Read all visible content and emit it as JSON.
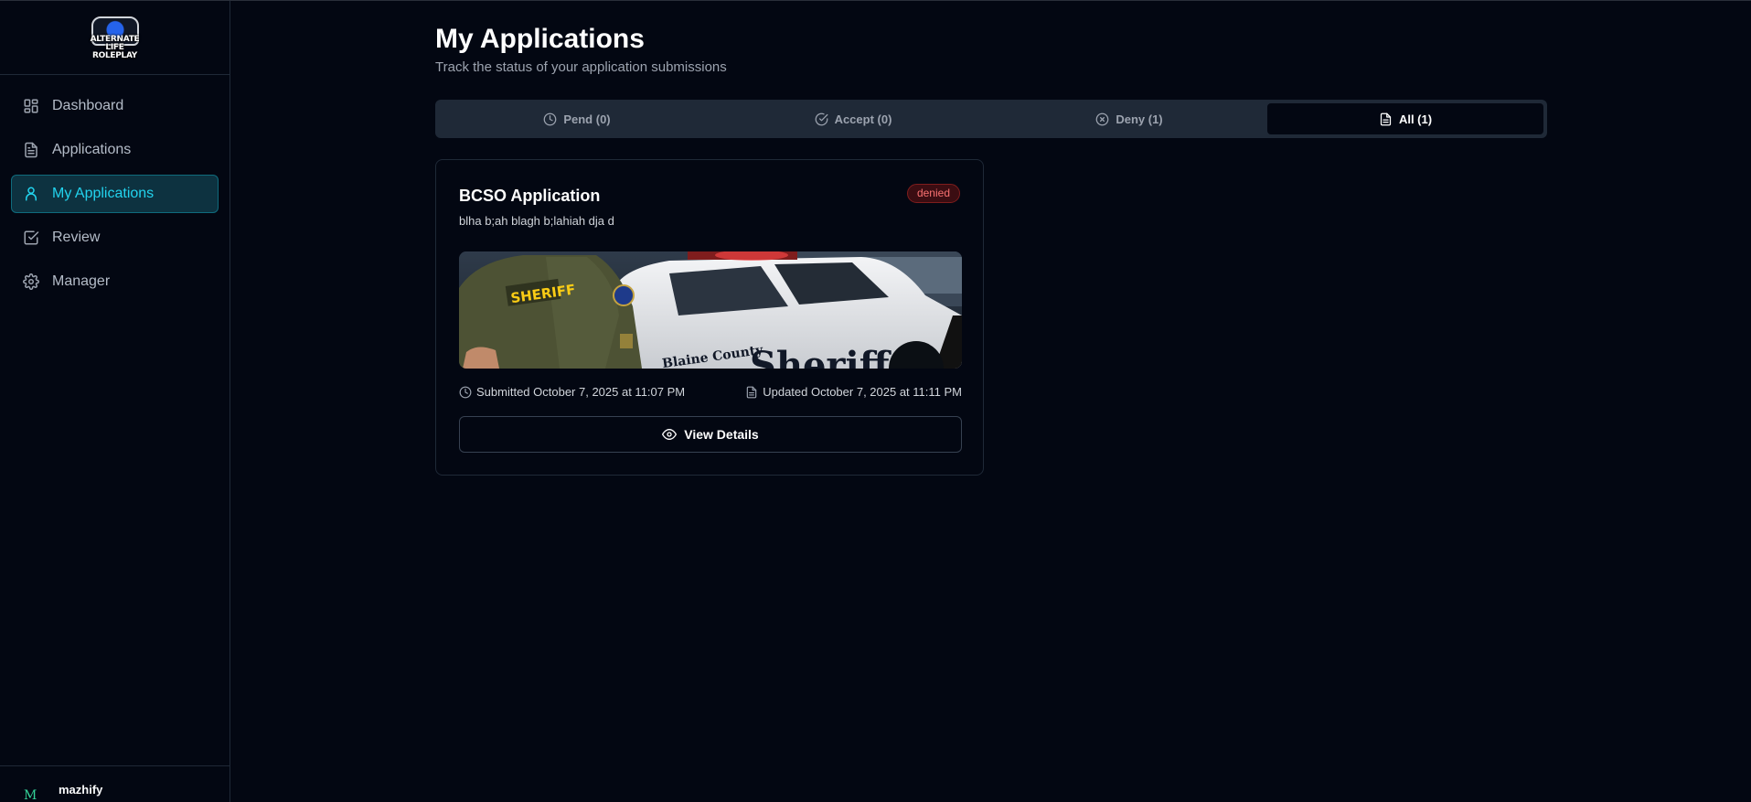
{
  "sidebar": {
    "logo": {
      "line1": "ALTERNATE LIFE",
      "line2": "ROLEPLAY"
    },
    "items": [
      {
        "label": "Dashboard",
        "icon": "grid-icon"
      },
      {
        "label": "Applications",
        "icon": "document-icon"
      },
      {
        "label": "My Applications",
        "icon": "user-icon",
        "active": true
      },
      {
        "label": "Review",
        "icon": "check-square-icon"
      },
      {
        "label": "Manager",
        "icon": "gear-icon"
      }
    ],
    "user": {
      "avatar_letter": "M",
      "name": "mazhify"
    }
  },
  "main": {
    "title": "My Applications",
    "subtitle": "Track the status of your application submissions",
    "tabs": [
      {
        "label": "Pend (0)",
        "icon": "clock-icon"
      },
      {
        "label": "Accept (0)",
        "icon": "check-circle-icon"
      },
      {
        "label": "Deny (1)",
        "icon": "x-circle-icon"
      },
      {
        "label": "All (1)",
        "icon": "document-icon",
        "active": true
      }
    ],
    "card": {
      "title": "BCSO Application",
      "status": "denied",
      "description": "blha b;ah blagh b;lahiah dja d",
      "image_labels": {
        "vest": "SHERIFF",
        "car_text": "Blaine County",
        "car_big": "Sheriff"
      },
      "submitted": "Submitted October 7, 2025 at 11:07 PM",
      "updated": "Updated October 7, 2025 at 11:11 PM",
      "view_button": "View Details"
    }
  },
  "colors": {
    "background": "#030712",
    "accent": "#22d3ee",
    "denied": "#f87171",
    "tab_bar": "#1f2937"
  }
}
